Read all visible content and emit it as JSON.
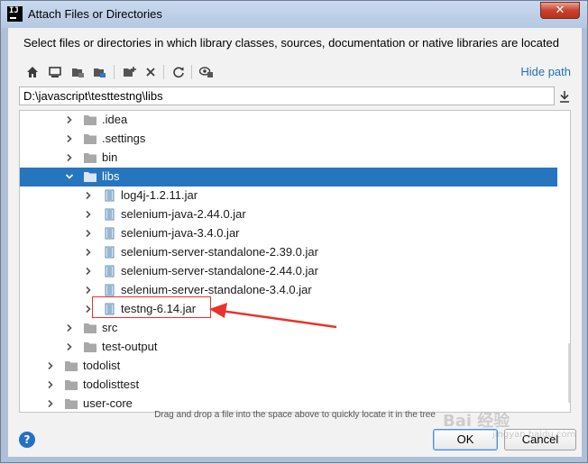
{
  "window": {
    "title": "Attach Files or Directories",
    "app_icon_text": "IJ",
    "close_glyph": "✕"
  },
  "description": "Select files or directories in which library classes, sources, documentation or native libraries are located",
  "toolbar": {
    "buttons": [
      "home-icon",
      "desktop-icon",
      "project-icon",
      "module-icon",
      "new-folder-icon",
      "delete-icon",
      "refresh-icon",
      "show-hidden-icon"
    ],
    "hide_path_label": "Hide path"
  },
  "path": {
    "value": "D:\\javascript\\testtestng\\libs"
  },
  "tree": {
    "rows": [
      {
        "label": ".idea",
        "type": "folder",
        "depth": 2,
        "expanded": false,
        "selected": false
      },
      {
        "label": ".settings",
        "type": "folder",
        "depth": 2,
        "expanded": false,
        "selected": false
      },
      {
        "label": "bin",
        "type": "folder",
        "depth": 2,
        "expanded": false,
        "selected": false
      },
      {
        "label": "libs",
        "type": "folder",
        "depth": 2,
        "expanded": true,
        "selected": true
      },
      {
        "label": "log4j-1.2.11.jar",
        "type": "jar",
        "depth": 3,
        "expanded": false,
        "selected": false
      },
      {
        "label": "selenium-java-2.44.0.jar",
        "type": "jar",
        "depth": 3,
        "expanded": false,
        "selected": false
      },
      {
        "label": "selenium-java-3.4.0.jar",
        "type": "jar",
        "depth": 3,
        "expanded": false,
        "selected": false
      },
      {
        "label": "selenium-server-standalone-2.39.0.jar",
        "type": "jar",
        "depth": 3,
        "expanded": false,
        "selected": false
      },
      {
        "label": "selenium-server-standalone-2.44.0.jar",
        "type": "jar",
        "depth": 3,
        "expanded": false,
        "selected": false
      },
      {
        "label": "selenium-server-standalone-3.4.0.jar",
        "type": "jar",
        "depth": 3,
        "expanded": false,
        "selected": false
      },
      {
        "label": "testng-6.14.jar",
        "type": "jar",
        "depth": 3,
        "expanded": false,
        "selected": false
      },
      {
        "label": "src",
        "type": "folder",
        "depth": 2,
        "expanded": false,
        "selected": false
      },
      {
        "label": "test-output",
        "type": "folder",
        "depth": 2,
        "expanded": false,
        "selected": false
      },
      {
        "label": "todolist",
        "type": "folder",
        "depth": 1,
        "expanded": false,
        "selected": false
      },
      {
        "label": "todolisttest",
        "type": "folder",
        "depth": 1,
        "expanded": false,
        "selected": false
      },
      {
        "label": "user-core",
        "type": "folder",
        "depth": 1,
        "expanded": false,
        "selected": false
      }
    ]
  },
  "hint": "Drag and drop a file into the space above to quickly locate it in the tree",
  "footer": {
    "help_label": "?",
    "ok_label": "OK",
    "cancel_label": "Cancel"
  },
  "watermark": {
    "text": "Bai 经验",
    "sub": "jingyan.baidu.com"
  },
  "colors": {
    "selection": "#2675bf",
    "link": "#2470b3",
    "annotation": "#e8332c"
  }
}
